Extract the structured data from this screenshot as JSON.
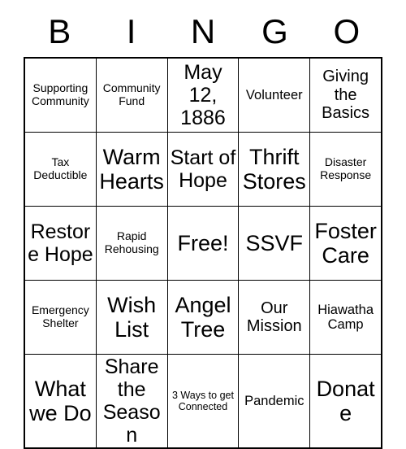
{
  "card": {
    "header_letters": [
      "B",
      "I",
      "N",
      "G",
      "O"
    ],
    "rows": [
      [
        {
          "text": "Supporting Community",
          "size": "fs-sm"
        },
        {
          "text": "Community Fund",
          "size": "fs-sm"
        },
        {
          "text": "May 12, 1886",
          "size": "fs-xl"
        },
        {
          "text": "Volunteer",
          "size": "fs-md"
        },
        {
          "text": "Giving the Basics",
          "size": "fs-lg"
        }
      ],
      [
        {
          "text": "Tax Deductible",
          "size": "fs-sm"
        },
        {
          "text": "Warm Hearts",
          "size": "fs-xxl"
        },
        {
          "text": "Start of Hope",
          "size": "fs-xl"
        },
        {
          "text": "Thrift Stores",
          "size": "fs-xxl"
        },
        {
          "text": "Disaster Response",
          "size": "fs-sm"
        }
      ],
      [
        {
          "text": "Restore Hope",
          "size": "fs-xl"
        },
        {
          "text": "Rapid Rehousing",
          "size": "fs-sm"
        },
        {
          "text": "Free!",
          "size": "fs-xxl"
        },
        {
          "text": "SSVF",
          "size": "fs-xxl"
        },
        {
          "text": "Foster Care",
          "size": "fs-xxl"
        }
      ],
      [
        {
          "text": "Emergency Shelter",
          "size": "fs-sm"
        },
        {
          "text": "Wish List",
          "size": "fs-xxl"
        },
        {
          "text": "Angel Tree",
          "size": "fs-xxl"
        },
        {
          "text": "Our Mission",
          "size": "fs-lg"
        },
        {
          "text": "Hiawatha Camp",
          "size": "fs-md"
        }
      ],
      [
        {
          "text": "What we Do",
          "size": "fs-xxl"
        },
        {
          "text": "Share the Season",
          "size": "fs-xl"
        },
        {
          "text": "3 Ways to get Connected",
          "size": "fs-xs"
        },
        {
          "text": "Pandemic",
          "size": "fs-md"
        },
        {
          "text": "Donate",
          "size": "fs-xxl"
        }
      ]
    ]
  }
}
